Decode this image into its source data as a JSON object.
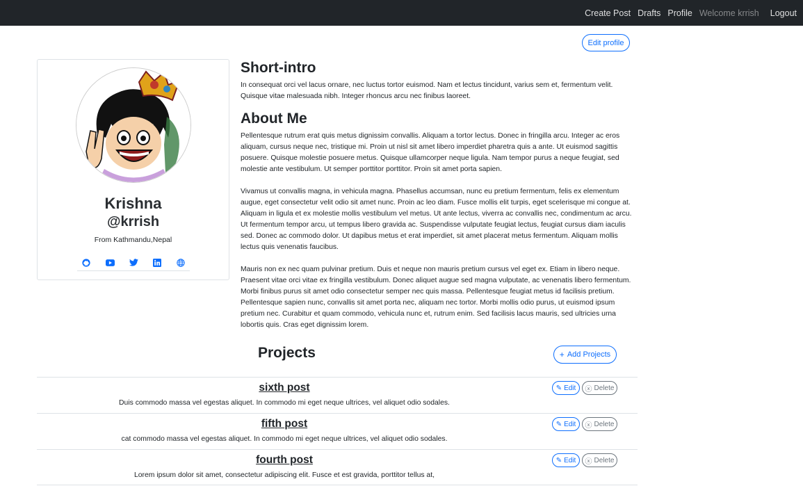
{
  "navbar": {
    "create_post": "Create Post",
    "drafts": "Drafts",
    "profile": "Profile",
    "welcome": "Welcome krrish",
    "logout": "Logout"
  },
  "edit_profile_label": "Edit profile",
  "profile": {
    "name": "Krishna",
    "handle": "@krrish",
    "location": "From Kathmandu,Nepal",
    "social_icons": [
      "github-icon",
      "youtube-icon",
      "twitter-icon",
      "linkedin-icon",
      "globe-icon"
    ]
  },
  "short_intro": {
    "heading": "Short-intro",
    "text": "In consequat orci vel lacus ornare, nec luctus tortor euismod. Nam et lectus tincidunt, varius sem et, fermentum velit. Quisque vitae malesuada nibh. Integer rhoncus arcu nec finibus laoreet."
  },
  "about": {
    "heading": "About Me",
    "paragraphs": [
      "Pellentesque rutrum erat quis metus dignissim convallis. Aliquam a tortor lectus. Donec in fringilla arcu. Integer ac eros aliquam, cursus neque nec, tristique mi. Proin ut nisl sit amet libero imperdiet pharetra quis a ante. Ut euismod sagittis posuere. Quisque molestie posuere metus. Quisque ullamcorper neque ligula. Nam tempor purus a neque feugiat, sed molestie ante vestibulum. Ut semper porttitor porttitor. Proin sit amet porta sapien.",
      "Vivamus ut convallis magna, in vehicula magna. Phasellus accumsan, nunc eu pretium fermentum, felis ex elementum augue, eget consectetur velit odio sit amet nunc. Proin ac leo diam. Fusce mollis elit turpis, eget scelerisque mi congue at. Aliquam in ligula et ex molestie mollis vestibulum vel metus. Ut ante lectus, viverra ac convallis nec, condimentum ac arcu. Ut fermentum tempor arcu, ut tempus libero gravida ac. Suspendisse vulputate feugiat lectus, feugiat cursus diam iaculis sed. Donec ac commodo dolor. Ut dapibus metus et erat imperdiet, sit amet placerat metus fermentum. Aliquam mollis lectus quis venenatis faucibus.",
      "Mauris non ex nec quam pulvinar pretium. Duis et neque non mauris pretium cursus vel eget ex. Etiam in libero neque. Praesent vitae orci vitae ex fringilla vestibulum. Donec aliquet augue sed magna vulputate, ac venenatis libero fermentum. Morbi finibus purus sit amet odio consectetur semper nec quis massa. Pellentesque feugiat metus id facilisis pretium. Pellentesque sapien nunc, convallis sit amet porta nec, aliquam nec tortor. Morbi mollis odio purus, ut euismod ipsum pretium nec. Curabitur et quam commodo, vehicula nunc et, rutrum enim. Sed facilisis lacus mauris, sed ultricies urna lobortis quis. Cras eget dignissim lorem."
    ]
  },
  "projects": {
    "heading": "Projects",
    "add_label": "Add Projects",
    "edit_label": "Edit",
    "delete_label": "Delete",
    "items": [
      {
        "title": "sixth post",
        "description": "Duis commodo massa vel egestas aliquet. In commodo mi eget neque ultrices, vel aliquet odio sodales."
      },
      {
        "title": "fifth post",
        "description": "cat commodo massa vel egestas aliquet. In commodo mi eget neque ultrices, vel aliquet odio sodales."
      },
      {
        "title": "fourth post",
        "description": "Lorem ipsum dolor sit amet, consectetur adipiscing elit. Fusce et est gravida, porttitor tellus at,"
      }
    ]
  },
  "colors": {
    "navbar_bg": "#212529",
    "primary": "#0d6efd",
    "secondary": "#6c757d"
  }
}
